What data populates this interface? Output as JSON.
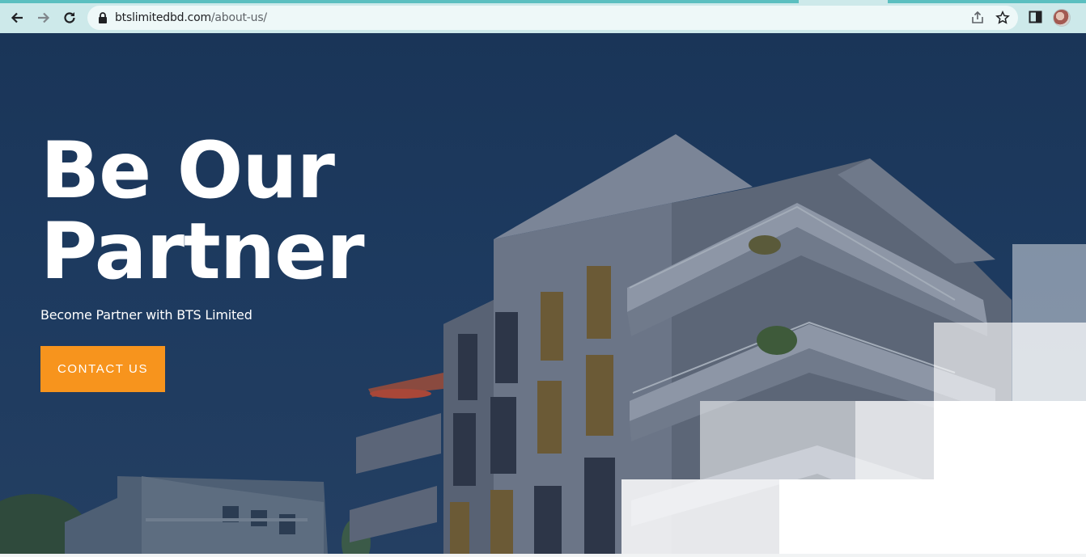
{
  "browser": {
    "url_host": "btslimitedbd.com",
    "url_path": "/about-us/",
    "icons": [
      "back-arrow-icon",
      "forward-arrow-icon",
      "reload-icon",
      "lock-icon",
      "share-icon",
      "star-icon",
      "side-panel-icon",
      "profile-avatar"
    ]
  },
  "hero": {
    "title_line1": "Be Our",
    "title_line2": "Partner",
    "subtitle": "Become Partner with BTS Limited",
    "cta_label": "CONTACT US"
  },
  "colors": {
    "overlay": "#1d3a5f",
    "cta": "#f7941d",
    "tab_strip": "#5bbfc0"
  }
}
